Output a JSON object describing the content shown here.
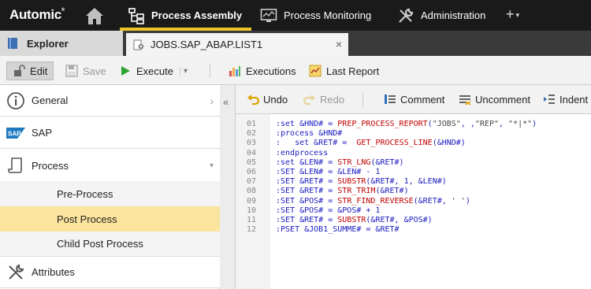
{
  "topbar": {
    "logo": "Automic",
    "logo_mark": "®",
    "nav": {
      "process_assembly": "Process Assembly",
      "process_monitoring": "Process Monitoring",
      "administration": "Administration",
      "plus": "+",
      "plus_caret": "▾"
    }
  },
  "tabs": {
    "explorer": "Explorer",
    "document": "JOBS.SAP_ABAP.LIST1",
    "close": "×"
  },
  "toolbar": {
    "edit": "Edit",
    "save": "Save",
    "execute": "Execute",
    "execute_caret": "▾",
    "executions": "Executions",
    "last_report": "Last Report"
  },
  "sidebar": {
    "general": "General",
    "sap": "SAP",
    "process": "Process",
    "sub": {
      "pre_process": "Pre-Process",
      "post_process": "Post Process",
      "child_post_process": "Child Post Process"
    },
    "attributes": "Attributes",
    "chev_right": "›",
    "chev_down": "▾",
    "collapse": "«"
  },
  "editor_toolbar": {
    "undo": "Undo",
    "redo": "Redo",
    "comment": "Comment",
    "uncomment": "Uncomment",
    "indent": "Indent"
  },
  "code": {
    "lines": [
      {
        "n": "01",
        "t": ":set &HND# = PREP_PROCESS_REPORT(\"JOBS\", ,\"REP\", \"*|*\")"
      },
      {
        "n": "02",
        "t": ":process &HND#"
      },
      {
        "n": "03",
        "t": ":   set &RET# =  GET_PROCESS_LINE(&HND#)"
      },
      {
        "n": "04",
        "t": ":endprocess"
      },
      {
        "n": "05",
        "t": ":set &LEN# = STR_LNG(&RET#)"
      },
      {
        "n": "06",
        "t": ":SET &LEN# = &LEN# - 1"
      },
      {
        "n": "07",
        "t": ":SET &RET# = SUBSTR(&RET#, 1, &LEN#)"
      },
      {
        "n": "08",
        "t": ":SET &RET# = STR_TRIM(&RET#)"
      },
      {
        "n": "09",
        "t": ":SET &POS# = STR_FIND_REVERSE(&RET#, ' ')"
      },
      {
        "n": "10",
        "t": ":SET &POS# = &POS# + 1"
      },
      {
        "n": "11",
        "t": ":SET &RET# = SUBSTR(&RET#, &POS#)"
      },
      {
        "n": "12",
        "t": ":PSET &JOB1_SUMME# = &RET#"
      }
    ]
  },
  "colors": {
    "topbar": "#1a1a1a",
    "accent": "#f1c32a",
    "active_item": "#fbe59e",
    "code_keyword": "#1b1bc0",
    "code_function": "#c20000"
  },
  "icons": {
    "home": "home-icon",
    "process_assembly": "process-tree-icon",
    "process_monitoring": "monitor-chart-icon",
    "administration": "wrench-screwdriver-icon",
    "explorer": "explorer-book-icon",
    "document": "job-gear-icon",
    "edit": "lock-open-icon",
    "save": "floppy-icon",
    "execute": "play-icon",
    "executions": "bar-chart-icon",
    "last_report": "report-icon",
    "general": "info-icon",
    "sap": "sap-logo-icon",
    "process": "scroll-icon",
    "attributes": "tools-icon",
    "undo": "undo-icon",
    "redo": "redo-icon",
    "comment": "comment-lines-icon",
    "uncomment": "uncomment-icon",
    "indent": "indent-icon"
  }
}
